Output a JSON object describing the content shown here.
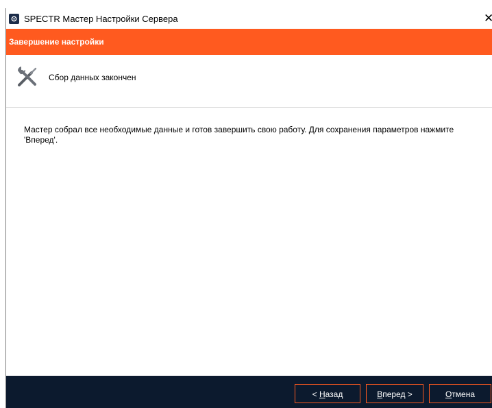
{
  "window": {
    "title": "SPECTR Мастер Настройки Сервера",
    "app_icon": "gear-icon",
    "close_glyph": "✕"
  },
  "banner": {
    "title": "Завершение настройки",
    "color": "#ff5a1f"
  },
  "header": {
    "icon": "tools-icon",
    "text": "Сбор данных закончен"
  },
  "content": {
    "message": "Мастер собрал все необходимые данные и готов завершить свою работу. Для сохранения параметров нажмите 'Вперед'."
  },
  "footer": {
    "background": "#0c1a2e",
    "buttons": {
      "back": {
        "prefix": "< ",
        "hotkey": "Н",
        "rest": "азад"
      },
      "next": {
        "prefix": "",
        "hotkey": "В",
        "rest": "перед >"
      },
      "cancel": {
        "prefix": "",
        "hotkey": "О",
        "rest": "тмена"
      }
    }
  }
}
